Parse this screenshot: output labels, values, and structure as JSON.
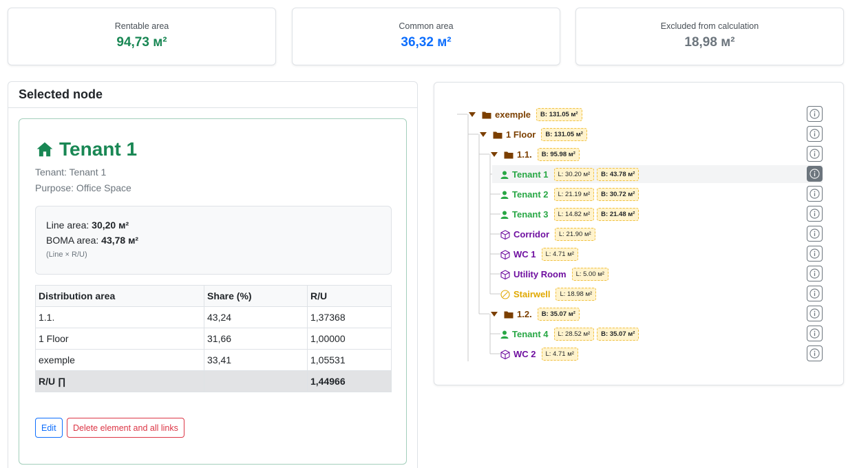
{
  "summary": {
    "rentable": {
      "label": "Rentable area",
      "value": "94,73 м²",
      "color": "#198754"
    },
    "common": {
      "label": "Common area",
      "value": "36,32 м²",
      "color": "#0d6efd"
    },
    "excluded": {
      "label": "Excluded from calculation",
      "value": "18,98 м²",
      "color": "#6c757d"
    }
  },
  "selected_panel": {
    "header": "Selected node",
    "title": "Tenant 1",
    "title_icon": "house-icon",
    "tenant_line": "Tenant: Tenant 1",
    "purpose_line": "Purpose: Office Space",
    "line_area_label": "Line area:",
    "line_area_value": "30,20 м²",
    "boma_area_label": "BOMA area:",
    "boma_area_value": "43,78 м²",
    "formula_note": "(Line × R/U)",
    "table": {
      "headers": [
        "Distribution area",
        "Share (%)",
        "R/U"
      ],
      "rows": [
        [
          "1.1.",
          "43,24",
          "1,37368"
        ],
        [
          "1 Floor",
          "31,66",
          "1,00000"
        ],
        [
          "exemple",
          "33,41",
          "1,05531"
        ]
      ],
      "total": {
        "label": "R/U ∏",
        "share": "",
        "value": "1,44966"
      }
    },
    "edit_label": "Edit",
    "delete_label": "Delete element and all links"
  },
  "tree": {
    "colors": {
      "folder": "#7b3f00",
      "tenant": "#28a745",
      "common": "#6f0fa0",
      "excluded": "#e0a800"
    },
    "nodes": [
      {
        "name": "exemple",
        "kind": "folder",
        "level": 0,
        "expanded": true,
        "badges": [
          {
            "text": "B: 131.05 м²",
            "type": "b"
          }
        ]
      },
      {
        "name": "1 Floor",
        "kind": "folder",
        "level": 1,
        "expanded": true,
        "badges": [
          {
            "text": "B: 131.05 м²",
            "type": "b"
          }
        ]
      },
      {
        "name": "1.1.",
        "kind": "folder",
        "level": 2,
        "expanded": true,
        "badges": [
          {
            "text": "B: 95.98 м²",
            "type": "b"
          }
        ]
      },
      {
        "name": "Tenant 1",
        "kind": "tenant",
        "level": 3,
        "selected": true,
        "badges": [
          {
            "text": "L: 30.20 м²",
            "type": "l"
          },
          {
            "text": "B: 43.78 м²",
            "type": "b"
          }
        ]
      },
      {
        "name": "Tenant 2",
        "kind": "tenant",
        "level": 3,
        "badges": [
          {
            "text": "L: 21.19 м²",
            "type": "l"
          },
          {
            "text": "B: 30.72 м²",
            "type": "b"
          }
        ]
      },
      {
        "name": "Tenant 3",
        "kind": "tenant",
        "level": 3,
        "badges": [
          {
            "text": "L: 14.82 м²",
            "type": "l"
          },
          {
            "text": "B: 21.48 м²",
            "type": "b"
          }
        ]
      },
      {
        "name": "Corridor",
        "kind": "common",
        "level": 3,
        "badges": [
          {
            "text": "L: 21.90 м²",
            "type": "l"
          }
        ]
      },
      {
        "name": "WC 1",
        "kind": "common",
        "level": 3,
        "badges": [
          {
            "text": "L: 4.71 м²",
            "type": "l"
          }
        ]
      },
      {
        "name": "Utility Room",
        "kind": "common",
        "level": 3,
        "badges": [
          {
            "text": "L: 5.00 м²",
            "type": "l"
          }
        ]
      },
      {
        "name": "Stairwell",
        "kind": "excluded",
        "level": 3,
        "badges": [
          {
            "text": "L: 18.98 м²",
            "type": "l"
          }
        ]
      },
      {
        "name": "1.2.",
        "kind": "folder",
        "level": 2,
        "expanded": true,
        "badges": [
          {
            "text": "B: 35.07 м²",
            "type": "b"
          }
        ]
      },
      {
        "name": "Tenant 4",
        "kind": "tenant",
        "level": 3,
        "badges": [
          {
            "text": "L: 28.52 м²",
            "type": "l"
          },
          {
            "text": "B: 35.07 м²",
            "type": "b"
          }
        ]
      },
      {
        "name": "WC 2",
        "kind": "common",
        "level": 3,
        "badges": [
          {
            "text": "L: 4.71 м²",
            "type": "l"
          }
        ]
      }
    ]
  }
}
